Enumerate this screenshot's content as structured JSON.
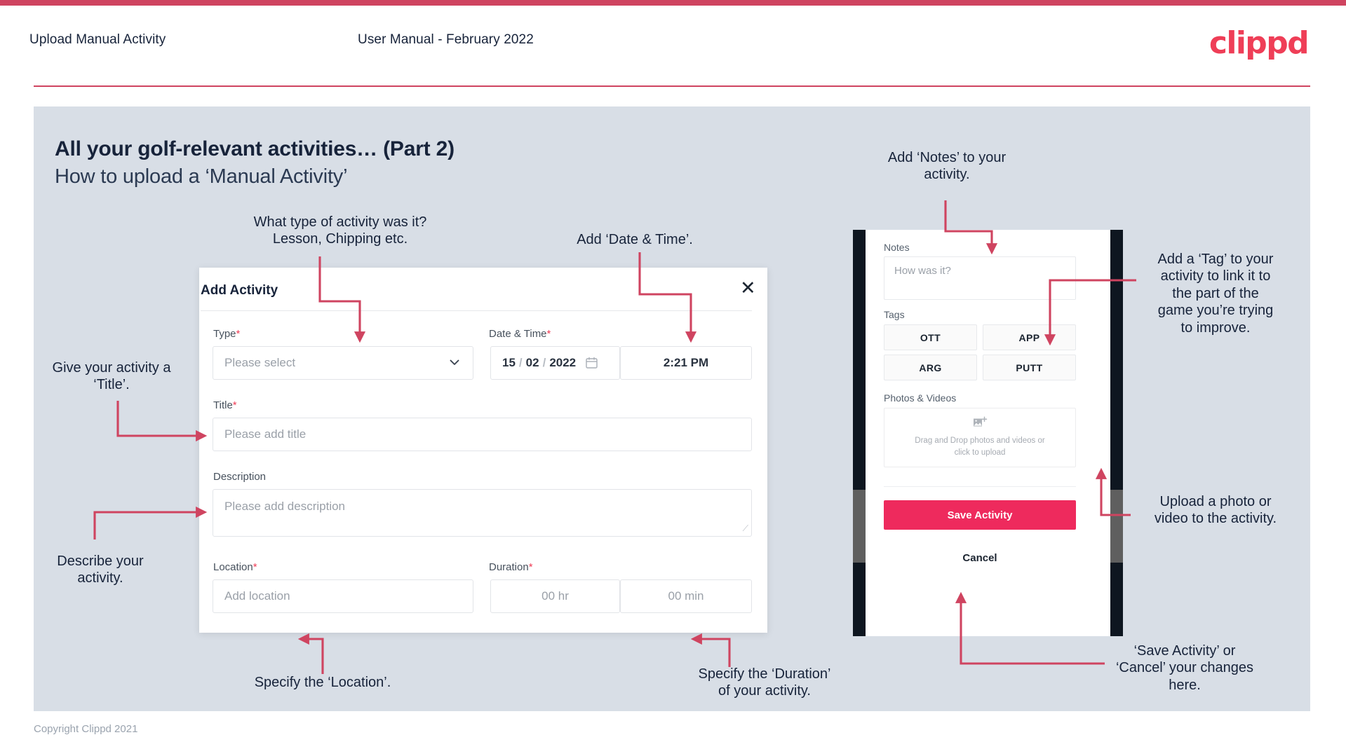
{
  "header": {
    "left_title": "Upload Manual Activity",
    "center_title": "User Manual - February 2022",
    "logo": "clippd"
  },
  "slide": {
    "title": "All your golf-relevant activities… (Part 2)",
    "subtitle": "How to upload a ‘Manual Activity’",
    "footer": "Copyright Clippd 2021"
  },
  "dialog": {
    "title": "Add Activity",
    "close_icon": "✕",
    "fields": {
      "type_label": "Type",
      "type_placeholder": "Please select",
      "datetime_label": "Date & Time",
      "date_day": "15",
      "date_month": "02",
      "date_year": "2022",
      "time_value": "2:21 PM",
      "title_label": "Title",
      "title_placeholder": "Please add title",
      "description_label": "Description",
      "description_placeholder": "Please add description",
      "location_label": "Location",
      "location_placeholder": "Add location",
      "duration_label": "Duration",
      "duration_hr_placeholder": "00 hr",
      "duration_min_placeholder": "00 min",
      "required_marker": "*"
    }
  },
  "phone": {
    "notes_label": "Notes",
    "notes_placeholder": "How was it?",
    "tags_label": "Tags",
    "tags": [
      "OTT",
      "APP",
      "ARG",
      "PUTT"
    ],
    "photos_label": "Photos & Videos",
    "dropzone_line1": "Drag and Drop photos and videos or",
    "dropzone_line2": "click to upload",
    "save_label": "Save Activity",
    "cancel_label": "Cancel"
  },
  "annotations": {
    "type": "What type of activity was it?\nLesson, Chipping etc.",
    "datetime": "Add ‘Date & Time’.",
    "notes": "Add ‘Notes’ to your\nactivity.",
    "tag": "Add a ‘Tag’ to your\nactivity to link it to\nthe part of the\ngame you’re trying\nto improve.",
    "title": "Give your activity a\n‘Title’.",
    "description": "Describe your\nactivity.",
    "location": "Specify the ‘Location’.",
    "duration": "Specify the ‘Duration’\nof your activity.",
    "upload": "Upload a photo or\nvideo to the activity.",
    "save_cancel": "‘Save Activity’ or\n‘Cancel’ your changes\nhere."
  },
  "colors": {
    "brand_pink": "#ef3e57",
    "arrow_red": "#cf4460",
    "panel_gray": "#d8dee6",
    "save_pink": "#ee2a5d",
    "text_dark": "#17233a"
  }
}
